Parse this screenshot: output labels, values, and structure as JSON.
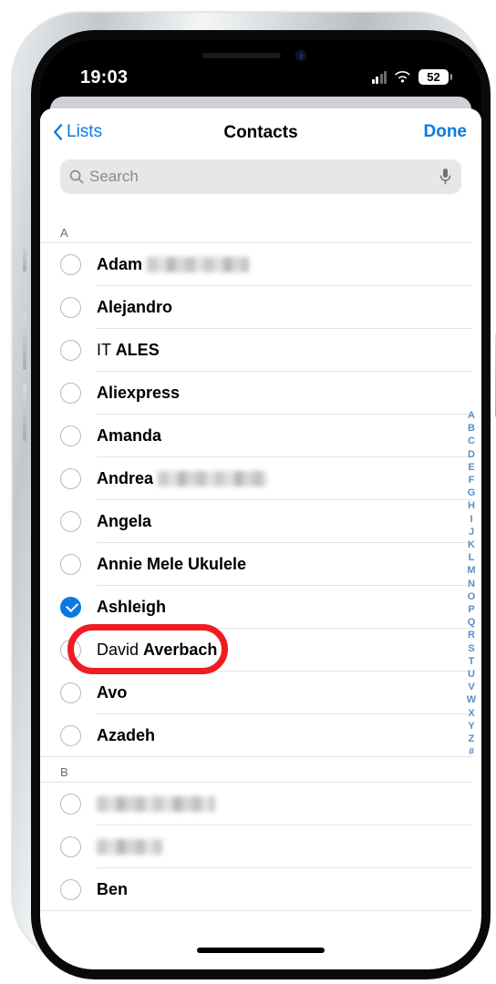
{
  "device": {
    "status_bar": {
      "time": "19:03",
      "cellular_icon": "cellular-bars-icon",
      "cellular_bars_active": 2,
      "cellular_bars_total": 4,
      "wifi_icon": "wifi-icon",
      "battery_icon": "battery-icon",
      "battery_level": "52"
    },
    "home_indicator": "home-indicator"
  },
  "sheet": {
    "nav": {
      "back_label": "Lists",
      "back_icon": "chevron-left-icon",
      "title": "Contacts",
      "done_label": "Done",
      "accent_color": "#0a7ae0"
    },
    "search": {
      "placeholder": "Search",
      "value": "",
      "search_icon": "search-icon",
      "mic_icon": "mic-icon"
    },
    "sections": [
      {
        "header": "A",
        "contacts": [
          {
            "first": "Adam",
            "last": "",
            "redacted": true,
            "redacted_width": 112,
            "selected": false
          },
          {
            "first": "Alejandro",
            "last": "",
            "redacted": false,
            "selected": false
          },
          {
            "first": "IT",
            "last": "ALES",
            "redacted": false,
            "selected": false
          },
          {
            "first": "Aliexpress",
            "last": "",
            "bold_all": true,
            "redacted": false,
            "selected": false
          },
          {
            "first": "Amanda",
            "last": "",
            "bold_all": true,
            "redacted": false,
            "selected": false
          },
          {
            "first": "Andrea",
            "last": "",
            "redacted": true,
            "redacted_width": 120,
            "selected": false
          },
          {
            "first": "Angela",
            "last": "",
            "bold_all": true,
            "redacted": false,
            "selected": false
          },
          {
            "first": "Annie Mele Ukulele",
            "last": "",
            "bold_all": true,
            "redacted": false,
            "selected": false
          },
          {
            "first": "Ashleigh",
            "last": "",
            "bold_all": true,
            "redacted": false,
            "selected": true
          },
          {
            "first": "David",
            "last": "Averbach",
            "redacted": false,
            "selected": false
          },
          {
            "first": "Avo",
            "last": "",
            "bold_all": true,
            "redacted": false,
            "selected": false
          },
          {
            "first": "Azadeh",
            "last": "",
            "bold_all": true,
            "redacted": false,
            "selected": false
          }
        ]
      },
      {
        "header": "B",
        "contacts": [
          {
            "first": "",
            "last": "",
            "redacted": true,
            "redacted_width": 130,
            "selected": false
          },
          {
            "first": "",
            "last": "",
            "redacted": true,
            "redacted_width": 72,
            "selected": false
          },
          {
            "first": "Ben",
            "last": "",
            "bold_all": true,
            "redacted": false,
            "selected": false
          }
        ]
      }
    ],
    "alpha_index": [
      "A",
      "B",
      "C",
      "D",
      "E",
      "F",
      "G",
      "H",
      "I",
      "J",
      "K",
      "L",
      "M",
      "N",
      "O",
      "P",
      "Q",
      "R",
      "S",
      "T",
      "U",
      "V",
      "W",
      "X",
      "Y",
      "Z",
      "#"
    ],
    "alpha_index_color": "#5a8fc7"
  },
  "annotation": {
    "type": "oval-highlight",
    "target": "Ashleigh",
    "color": "#ee1d23"
  }
}
